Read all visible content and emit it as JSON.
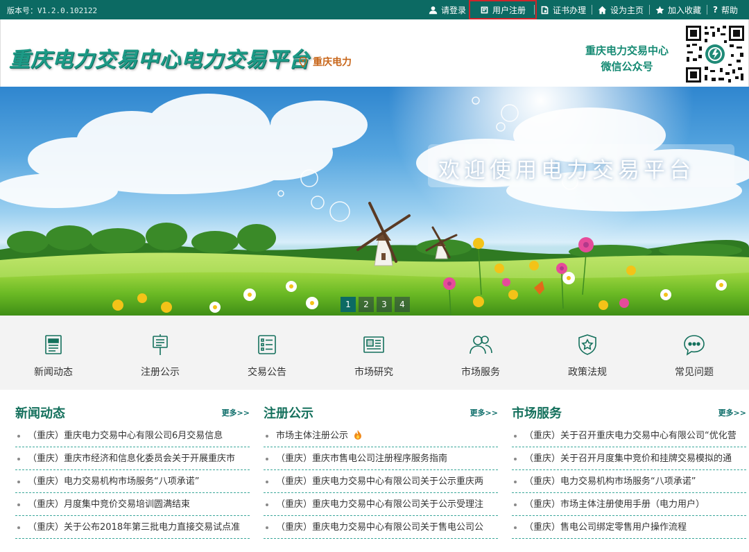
{
  "topbar": {
    "version": "版本号：V1.2.0.102122",
    "links": {
      "login": "请登录",
      "register": "用户注册",
      "certificate": "证书办理",
      "homepage": "设为主页",
      "favorite": "加入收藏",
      "help": "帮助"
    }
  },
  "header": {
    "title": "重庆电力交易中心电力交易平台",
    "region": "重庆电力",
    "wechat_line1": "重庆电力交易中心",
    "wechat_line2": "微信公众号"
  },
  "banner": {
    "welcome": "欢迎使用电力交易平台",
    "pages": [
      "1",
      "2",
      "3",
      "4"
    ],
    "active_page": 1
  },
  "quicknav": [
    {
      "label": "新闻动态",
      "icon": "newspaper-icon"
    },
    {
      "label": "注册公示",
      "icon": "signboard-icon"
    },
    {
      "label": "交易公告",
      "icon": "list-icon"
    },
    {
      "label": "市场研究",
      "icon": "report-icon"
    },
    {
      "label": "市场服务",
      "icon": "users-icon"
    },
    {
      "label": "政策法规",
      "icon": "shield-star-icon"
    },
    {
      "label": "常见问题",
      "icon": "chat-bubble-icon"
    }
  ],
  "columns": {
    "news": {
      "title": "新闻动态",
      "more": "更多>>",
      "items": [
        "（重庆）重庆电力交易中心有限公司6月交易信息",
        "（重庆）重庆市经济和信息化委员会关于开展重庆市",
        "（重庆）电力交易机构市场服务“八项承诺”",
        "（重庆）月度集中竞价交易培训圆满结束",
        "（重庆）关于公布2018年第三批电力直接交易试点准"
      ]
    },
    "registration": {
      "title": "注册公示",
      "more": "更多>>",
      "items": [
        "市场主体注册公示",
        "（重庆）重庆市售电公司注册程序服务指南",
        "（重庆）重庆电力交易中心有限公司关于公示重庆两",
        "（重庆）重庆电力交易中心有限公司关于公示受理注",
        "（重庆）重庆电力交易中心有限公司关于售电公司公"
      ]
    },
    "service": {
      "title": "市场服务",
      "more": "更多>>",
      "items": [
        "（重庆）关于召开重庆电力交易中心有限公司“优化营",
        "（重庆）关于召开月度集中竞价和挂牌交易模拟的通",
        "（重庆）电力交易机构市场服务“八项承诺”",
        "（重庆）市场主体注册使用手册（电力用户）",
        "（重庆）售电公司绑定零售用户操作流程"
      ]
    }
  },
  "colors": {
    "topbar": "#0c6a63",
    "accent": "#14705c",
    "highlight": "#d0242a",
    "region": "#c8661a"
  }
}
